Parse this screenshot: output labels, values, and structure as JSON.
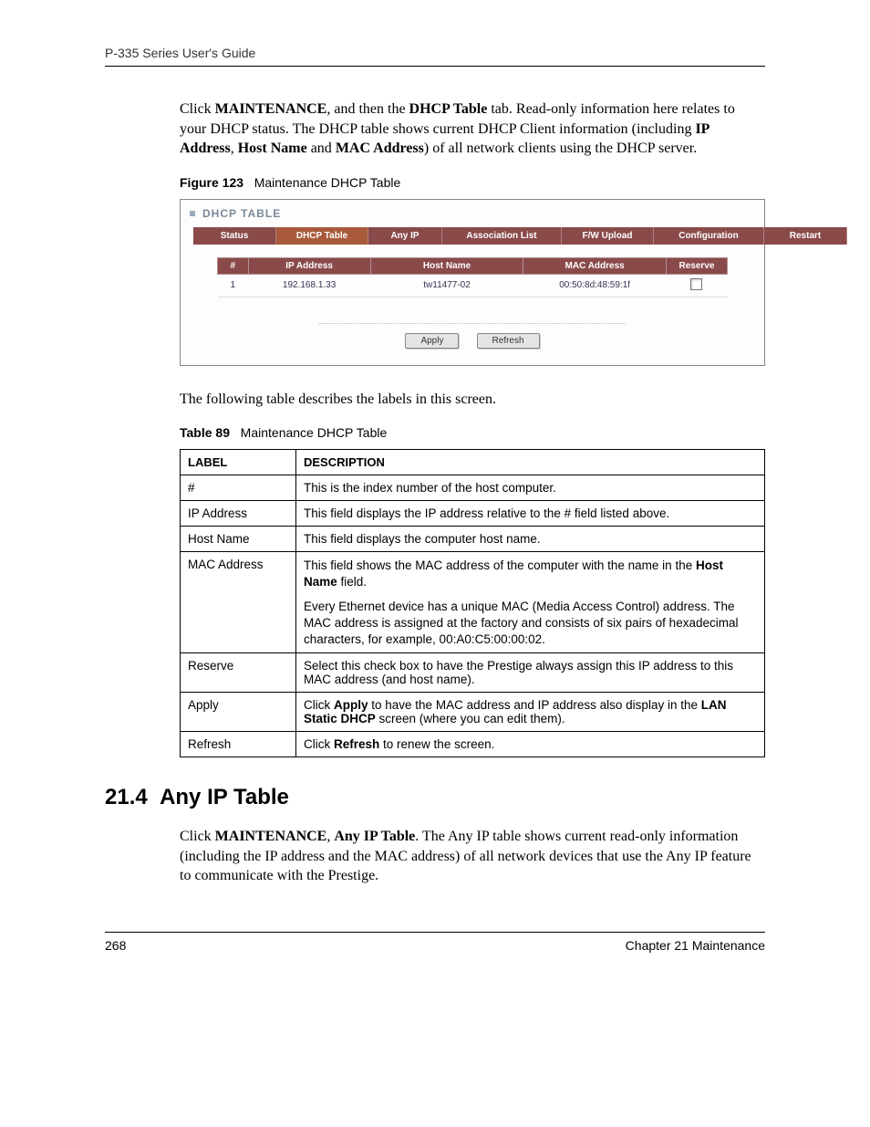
{
  "header": "P-335 Series User's Guide",
  "intro": {
    "pre1": "Click ",
    "b1": "MAINTENANCE",
    "mid1": ", and then the ",
    "b2": "DHCP Table",
    "mid2": " tab. Read-only information here relates to your DHCP status. The DHCP table shows current DHCP Client information (including ",
    "b3": "IP Address",
    "mid3": ", ",
    "b4": "Host Name",
    "mid4": " and ",
    "b5": "MAC Address",
    "post": ") of all network clients using the DHCP server."
  },
  "figure": {
    "num": "Figure 123",
    "title": "Maintenance DHCP Table"
  },
  "screenshot": {
    "window_title": "DHCP TABLE",
    "tabs": [
      "Status",
      "DHCP Table",
      "Any IP",
      "Association List",
      "F/W Upload",
      "Configuration",
      "Restart"
    ],
    "active_tab_index": 1,
    "headers": [
      "#",
      "IP Address",
      "Host Name",
      "MAC Address",
      "Reserve"
    ],
    "row": {
      "num": "1",
      "ip": "192.168.1.33",
      "host": "tw11477-02",
      "mac": "00:50:8d:48:59:1f"
    },
    "buttons": {
      "apply": "Apply",
      "refresh": "Refresh"
    }
  },
  "mid_text": "The following table describes the labels in this screen.",
  "table_caption": {
    "num": "Table 89",
    "title": "Maintenance DHCP Table"
  },
  "desc": {
    "h_label": "LABEL",
    "h_desc": "DESCRIPTION",
    "rows": {
      "r0": {
        "label": "#",
        "d": "This is the index number of the host computer."
      },
      "r1": {
        "label": "IP Address",
        "d": "This field displays the IP address relative to the # field listed above."
      },
      "r2": {
        "label": "Host Name",
        "d": "This field displays the computer host name."
      },
      "r3": {
        "label": "MAC Address",
        "p1a": "This field shows the MAC address of the computer with the name in the ",
        "p1b": "Host Name",
        "p1c": " field.",
        "p2": "Every Ethernet device has a unique MAC (Media Access Control) address. The MAC address is assigned at the factory and consists of six pairs of hexadecimal characters, for example, 00:A0:C5:00:00:02."
      },
      "r4": {
        "label": "Reserve",
        "d": "Select this check box to have the Prestige always assign this IP address to this MAC address (and host name)."
      },
      "r5": {
        "label": "Apply",
        "a": "Click ",
        "b": "Apply",
        "c": " to have the MAC address and IP address also display in the ",
        "d": "LAN Static DHCP",
        "e": " screen (where you can edit them)."
      },
      "r6": {
        "label": "Refresh",
        "a": "Click ",
        "b": "Refresh",
        "c": " to renew the screen."
      }
    }
  },
  "section": {
    "num": "21.4",
    "title": "Any IP Table"
  },
  "section_body": {
    "pre": "Click ",
    "b1": "MAINTENANCE",
    "mid": ", ",
    "b2": "Any IP Table",
    "post": ". The Any IP table shows current read-only information (including the IP address and the MAC address) of all network devices that use the Any IP feature to communicate with the Prestige."
  },
  "footer": {
    "page": "268",
    "chapter": "Chapter 21 Maintenance"
  }
}
